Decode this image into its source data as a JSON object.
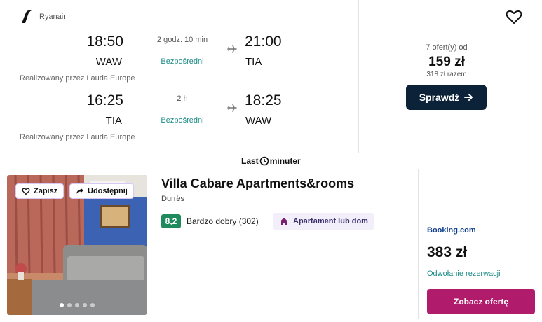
{
  "flight": {
    "airline": {
      "name": "Ryanair",
      "icon": "ryanair-logo-icon"
    },
    "legs": [
      {
        "departure_time": "18:50",
        "departure_code": "WAW",
        "duration": "2 godz. 10 min",
        "stops": "Bezpośredni",
        "arrival_time": "21:00",
        "arrival_code": "TIA",
        "operator": "Realizowany przez Lauda Europe"
      },
      {
        "departure_time": "16:25",
        "departure_code": "TIA",
        "duration": "2 h",
        "stops": "Bezpośredni",
        "arrival_time": "18:25",
        "arrival_code": "WAW",
        "operator": "Realizowany przez Lauda Europe"
      }
    ],
    "offers_count": "7 ofert(y) od",
    "price": "159 zł",
    "total_price": "318 zł razem",
    "check_button": "Sprawdź",
    "favorite_icon": "heart-outline-icon"
  },
  "partner": {
    "name_left": "Last",
    "name_right": "minuter",
    "icon": "clock-icon"
  },
  "hotel": {
    "name": "Villa Cabare Apartments&rooms",
    "city": "Durrës",
    "rating": "8,2",
    "rating_label": "Bardzo dobry (302)",
    "type": "Apartament lub dom",
    "save_button": "Zapisz",
    "share_button": "Udostępnij",
    "photo_count": 5,
    "active_photo": 0,
    "provider": "Booking.com",
    "price": "383 zł",
    "cancellation": "Odwołanie rezerwacji",
    "offer_button": "Zobacz ofertę"
  },
  "colors": {
    "dark_button": "#0b2238",
    "offer_button": "#b01c6b",
    "teal_text": "#1c8c86",
    "rating_green": "#1f8a5b",
    "booking_blue": "#0d3c8c"
  }
}
